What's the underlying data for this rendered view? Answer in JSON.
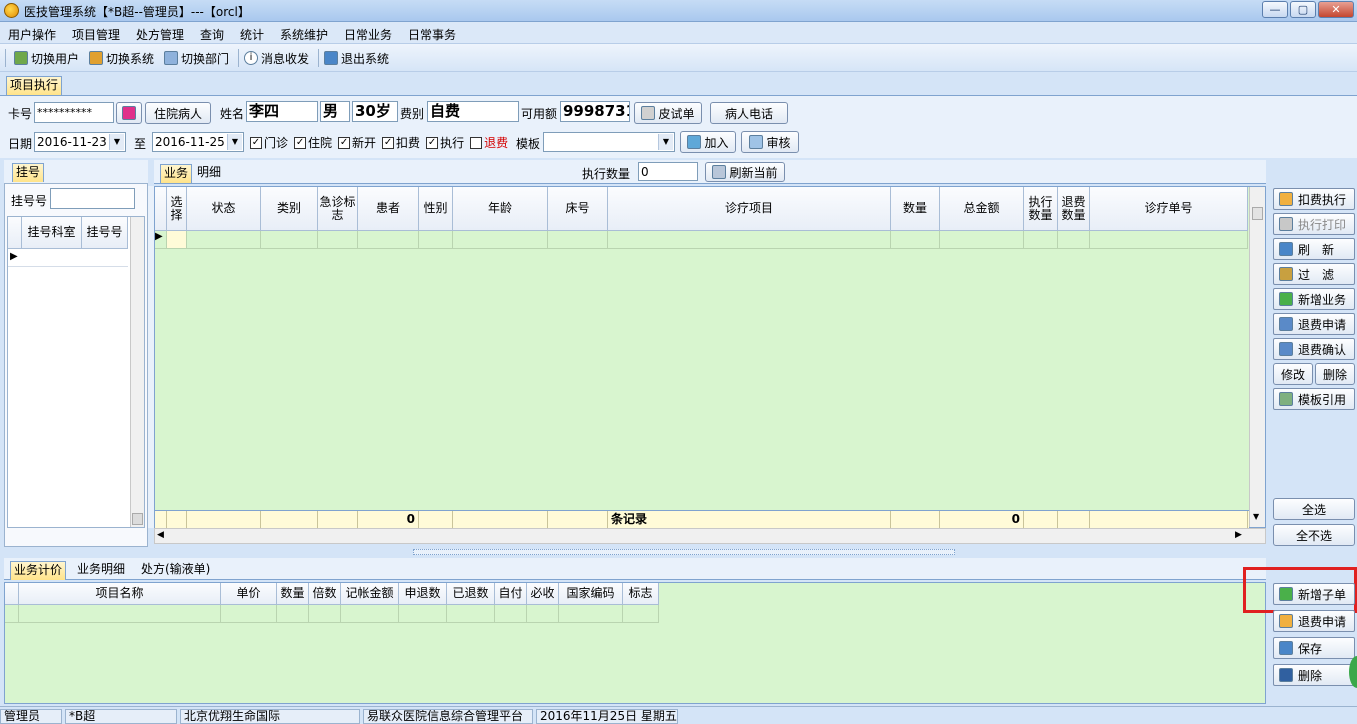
{
  "window": {
    "title": "医技管理系统【*B超--管理员】---【orcl】",
    "controls": [
      "—",
      "▢",
      "✕"
    ]
  },
  "menu": [
    "用户操作",
    "项目管理",
    "处方管理",
    "查询",
    "统计",
    "系统维护",
    "日常业务",
    "日常事务"
  ],
  "toolbar": [
    {
      "label": "切换用户",
      "icon": "users-icon"
    },
    {
      "label": "切换系统",
      "icon": "switch-system-icon"
    },
    {
      "label": "切换部门",
      "icon": "department-icon"
    },
    {
      "label": "消息收发",
      "icon": "info-icon"
    },
    {
      "label": "退出系统",
      "icon": "exit-icon"
    }
  ],
  "main_tab": "项目执行",
  "form": {
    "card_label": "卡号",
    "card_value": "**********",
    "patient_type_button": "住院病人",
    "name_label": "姓名",
    "name_value": "李四",
    "sex_value": "男",
    "age_value": "30岁",
    "fee_type_label": "费别",
    "fee_type_value": "自费",
    "balance_label": "可用额",
    "balance_value": "9998731",
    "test_sheet_button": "皮试单",
    "phone_button": "病人电话",
    "date_label": "日期",
    "date_from": "2016-11-23",
    "to_label": "至",
    "date_to": "2016-11-25",
    "checks": [
      {
        "label": "门诊",
        "checked": true
      },
      {
        "label": "住院",
        "checked": true
      },
      {
        "label": "新开",
        "checked": true
      },
      {
        "label": "扣费",
        "checked": true
      },
      {
        "label": "执行",
        "checked": true
      },
      {
        "label": "退费",
        "checked": false,
        "color": "#d40000"
      }
    ],
    "template_label": "模板",
    "template_value": "",
    "add_button": "加入",
    "review_button": "审核"
  },
  "left": {
    "tab": "挂号",
    "reg_no_label": "挂号号",
    "reg_no_value": "",
    "columns": [
      "挂号科室",
      "挂号号"
    ]
  },
  "business_tabs": [
    "业务",
    "明细"
  ],
  "exec_qty_label": "执行数量",
  "exec_qty_value": "0",
  "refresh_button": "刷新当前",
  "main_grid": {
    "columns": [
      "选择",
      "状态",
      "类别",
      "急诊标志",
      "患者",
      "性别",
      "年龄",
      "床号",
      "诊疗项目",
      "数量",
      "总金额",
      "执行数量",
      "退费数量",
      "诊疗单号"
    ],
    "footer": {
      "patients": "0",
      "records": "条记录",
      "amount": "0"
    }
  },
  "side_buttons": [
    {
      "label": "扣费执行",
      "icon": "hand-icon",
      "enabled": true
    },
    {
      "label": "执行打印",
      "icon": "printer-icon",
      "enabled": false
    },
    {
      "label": "刷　新",
      "icon": "refresh-icon",
      "enabled": true
    },
    {
      "label": "过　滤",
      "icon": "filter-icon",
      "enabled": true
    },
    {
      "label": "新增业务",
      "icon": "add-icon",
      "enabled": true
    },
    {
      "label": "退费申请",
      "icon": "refund-request-icon",
      "enabled": true
    },
    {
      "label": "退费确认",
      "icon": "refund-confirm-icon",
      "enabled": true
    }
  ],
  "edit_button": "修改",
  "delete_small_button": "删除",
  "template_ref_button": "模板引用",
  "select_all_button": "全选",
  "select_none_button": "全不选",
  "bottom_tabs": [
    "业务计价",
    "业务明细",
    "处方(输液单)"
  ],
  "bottom_grid": {
    "columns": [
      "项目名称",
      "单价",
      "数量",
      "倍数",
      "记帐金额",
      "申退数",
      "已退数",
      "自付",
      "必收",
      "国家编码",
      "标志"
    ]
  },
  "bottom_buttons": [
    {
      "label": "新增子单",
      "icon": "add-icon"
    },
    {
      "label": "退费申请",
      "icon": "hand-icon"
    },
    {
      "label": "保存",
      "icon": "save-icon"
    },
    {
      "label": "删除",
      "icon": "delete-icon"
    }
  ],
  "highlight_color": "#e02020",
  "status": [
    "管理员",
    "*B超",
    "北京优翔生命国际",
    "易联众医院信息综合管理平台",
    "2016年11月25日 星期五"
  ]
}
